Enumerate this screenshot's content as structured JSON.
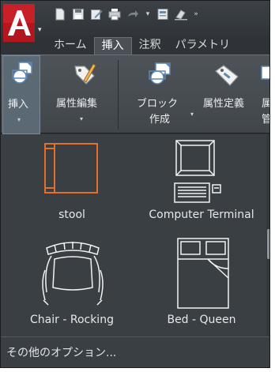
{
  "app": {
    "logo_letter": "A",
    "accent": "#c8252c"
  },
  "quick_access": [
    "new-icon",
    "save-icon",
    "edit-icon",
    "print-icon",
    "redo-icon",
    "dropdown-icon",
    "layer-icon",
    "erase-icon",
    "more-icon"
  ],
  "tabs": [
    {
      "label": "ホーム",
      "active": false
    },
    {
      "label": "挿入",
      "active": true
    },
    {
      "label": "注釈",
      "active": false
    },
    {
      "label": "パラメトリ",
      "active": false
    }
  ],
  "ribbon": {
    "insert_label": "挿入",
    "insert_arrow": "▾",
    "edit_attr_label": "属性編集",
    "edit_attr_arrow": "▾",
    "create_block_label_1": "ブロック",
    "create_block_label_2": "作成",
    "create_block_arrow": "▾",
    "define_attr_label": "属性定義",
    "manage_label_1": "属",
    "manage_label_2": "管"
  },
  "gallery": {
    "items": [
      {
        "label": "stool",
        "icon": "stool-icon",
        "highlighted": true
      },
      {
        "label": "Computer Terminal",
        "icon": "computer-terminal-icon",
        "highlighted": false
      },
      {
        "label": "Chair - Rocking",
        "icon": "rocking-chair-icon",
        "highlighted": false
      },
      {
        "label": "Bed - Queen",
        "icon": "queen-bed-icon",
        "highlighted": false
      }
    ],
    "highlight_color": "#e3702a"
  },
  "footer": {
    "more_options": "その他のオプション..."
  }
}
